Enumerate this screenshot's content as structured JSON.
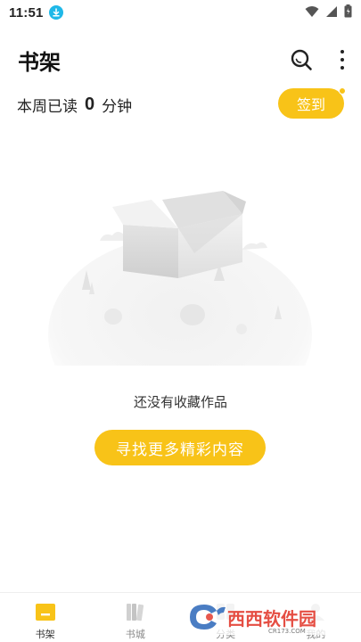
{
  "status_bar": {
    "time": "11:51",
    "icons": [
      "download-badge-icon",
      "wifi-icon",
      "signal-icon",
      "battery-icon"
    ]
  },
  "header": {
    "title": "书架",
    "icons": [
      "search-icon",
      "more-vert-icon"
    ]
  },
  "reading": {
    "prefix": "本周已读",
    "minutes": "0",
    "unit": "分钟"
  },
  "checkin": {
    "label": "签到"
  },
  "empty_state": {
    "message": "还没有收藏作品",
    "button_label": "寻找更多精彩内容"
  },
  "bottom_nav": {
    "items": [
      {
        "label": "书架",
        "icon": "bookshelf-icon",
        "active": true
      },
      {
        "label": "书城",
        "icon": "bookstore-icon",
        "active": false
      },
      {
        "label": "分类",
        "icon": "category-icon",
        "active": false
      },
      {
        "label": "我的",
        "icon": "profile-icon",
        "active": false
      }
    ]
  },
  "watermark": {
    "text": "西西软件园",
    "url_text": "CR173.COM"
  },
  "colors": {
    "accent": "#f8c318",
    "text": "#222222",
    "muted": "#888888"
  }
}
